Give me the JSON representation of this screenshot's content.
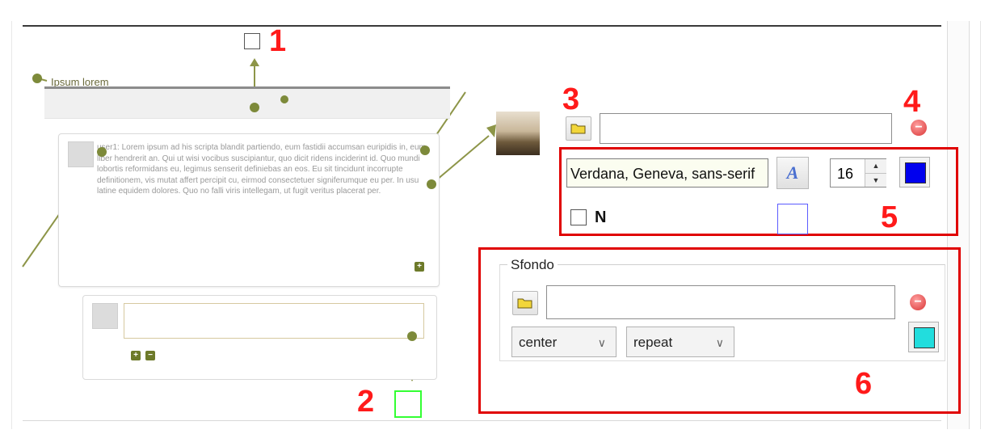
{
  "callouts": [
    "1",
    "2",
    "3",
    "4",
    "5",
    "6"
  ],
  "preview": {
    "title": "Ipsum lorem",
    "post_text": "user1: Lorem ipsum ad his scripta blandit partiendo, eum fastidii accumsan euripidis in, eum liber hendrerit an. Qui ut wisi vocibus suscipiantur, quo dicit ridens inciderint id. Quo mundi lobortis reformidans eu, legimus senserit definiebas an eos. Eu sit tincidunt incorrupte definitionem, vis mutat affert percipit cu, eirmod consectetuer signiferumque eu per. In usu latine equidem dolores. Quo no falli viris intellegam, ut fugit veritus placerat per.",
    "plus_btn": "+",
    "minus_btn": "−"
  },
  "image_controls": {
    "folder_icon": "folder-open-icon",
    "path_value": "",
    "remove_icon": "remove-icon",
    "remove_glyph": "−"
  },
  "font_controls": {
    "font_family": "Verdana, Geneva, sans-serif",
    "style_glyph": "A",
    "font_size": "16",
    "spin_up": "▲",
    "spin_down": "▼",
    "text_color": "#0000ee",
    "bold_label": "N",
    "border_color": "#5b5bff"
  },
  "background": {
    "legend": "Sfondo",
    "path_value": "",
    "position": "center",
    "repeat": "repeat",
    "color": "#22dddd",
    "remove_glyph": "−"
  },
  "colors": {
    "accent": "#7d8a3a",
    "callout": "#ff1a1a",
    "hotspot_green": "#33ff33"
  }
}
